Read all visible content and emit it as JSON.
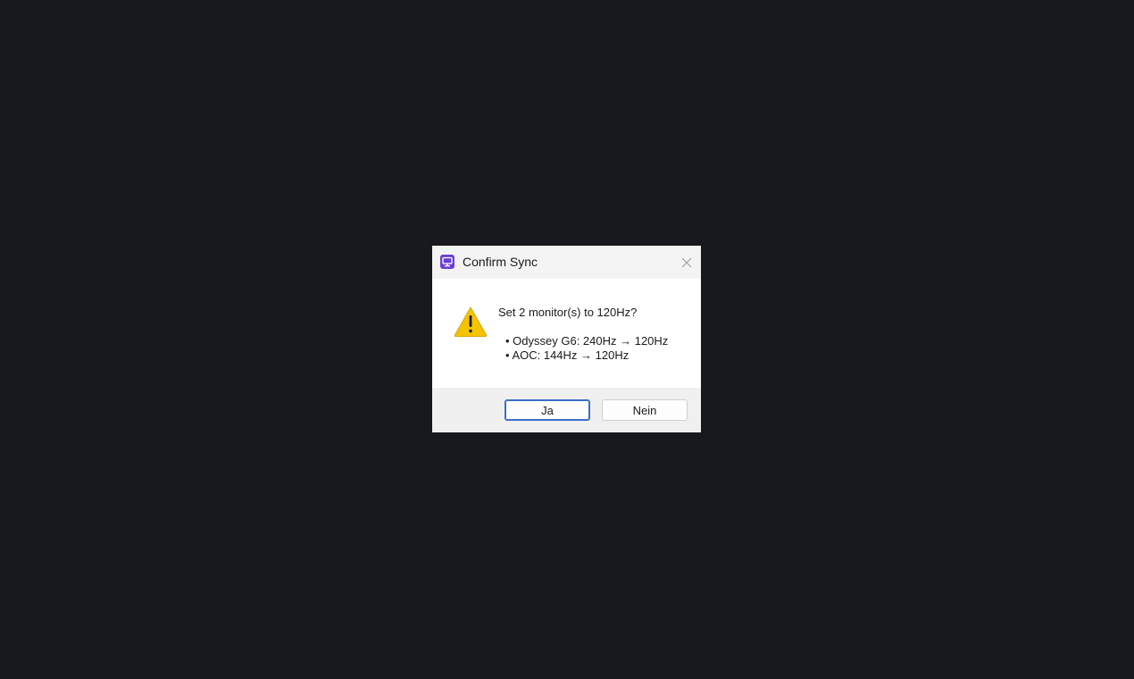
{
  "dialog": {
    "title": "Confirm Sync",
    "app_icon": "monitor-app-icon",
    "close_icon": "close-icon",
    "warning_icon": "warning-icon",
    "message": "Set 2 monitor(s) to 120Hz?",
    "details": [
      "• Odyssey G6: 240Hz → 120Hz",
      "• AOC: 144Hz → 120Hz"
    ],
    "buttons": {
      "yes_label": "Ja",
      "no_label": "Nein"
    },
    "colors": {
      "background": "#18181f",
      "app_icon": "#6b3fd4",
      "warning": "#f5c400",
      "default_button_border": "#3a6ec9"
    }
  }
}
